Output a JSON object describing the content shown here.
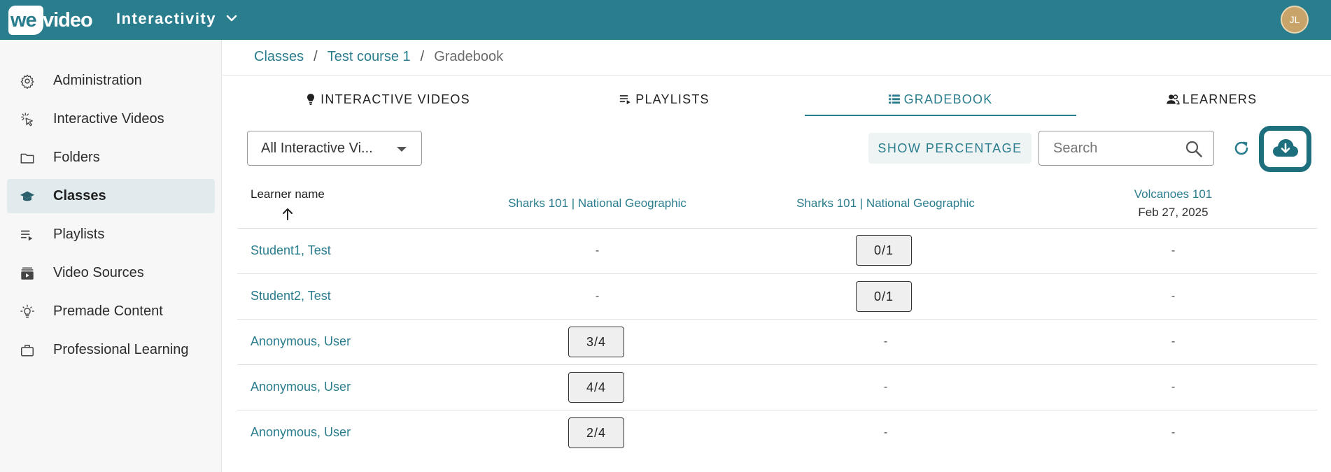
{
  "topbar": {
    "logo_we": "we",
    "logo_video": "video",
    "app_title": "Interactivity",
    "user_initials": "JL",
    "bg_color": "#2a7d8d"
  },
  "sidebar": {
    "items": [
      {
        "label": "Administration",
        "icon": "gear-icon"
      },
      {
        "label": "Interactive Videos",
        "icon": "cursor-click-icon"
      },
      {
        "label": "Folders",
        "icon": "folder-icon"
      },
      {
        "label": "Classes",
        "icon": "graduation-cap-icon",
        "active": true
      },
      {
        "label": "Playlists",
        "icon": "playlist-icon"
      },
      {
        "label": "Video Sources",
        "icon": "video-stack-icon"
      },
      {
        "label": "Premade Content",
        "icon": "lightbulb-icon"
      },
      {
        "label": "Professional Learning",
        "icon": "briefcase-icon"
      }
    ]
  },
  "breadcrumb": {
    "items": [
      "Classes",
      "Test course 1"
    ],
    "current": "Gradebook",
    "separator": "/"
  },
  "tabs": [
    {
      "label": "INTERACTIVE VIDEOS",
      "icon": "lightbulb-icon"
    },
    {
      "label": "PLAYLISTS",
      "icon": "playlist-icon"
    },
    {
      "label": "GRADEBOOK",
      "icon": "list-icon",
      "active": true
    },
    {
      "label": "LEARNERS",
      "icon": "people-icon"
    }
  ],
  "toolbar": {
    "filter_value": "All Interactive Vi...",
    "show_percentage_label": "SHOW PERCENTAGE",
    "search_placeholder": "Search"
  },
  "table": {
    "learner_header": "Learner name",
    "columns": [
      {
        "title": "Sharks 101 | National Geographic",
        "date": ""
      },
      {
        "title": "Sharks 101 | National Geographic",
        "date": ""
      },
      {
        "title": "Volcanoes 101",
        "date": "Feb 27, 2025"
      }
    ],
    "rows": [
      {
        "name": "Student1, Test",
        "cells": [
          "-",
          "0/1",
          "-"
        ]
      },
      {
        "name": "Student2, Test",
        "cells": [
          "-",
          "0/1",
          "-"
        ]
      },
      {
        "name": "Anonymous, User",
        "cells": [
          "3/4",
          "-",
          "-"
        ]
      },
      {
        "name": "Anonymous, User",
        "cells": [
          "4/4",
          "-",
          "-"
        ]
      },
      {
        "name": "Anonymous, User",
        "cells": [
          "2/4",
          "-",
          "-"
        ]
      }
    ]
  }
}
